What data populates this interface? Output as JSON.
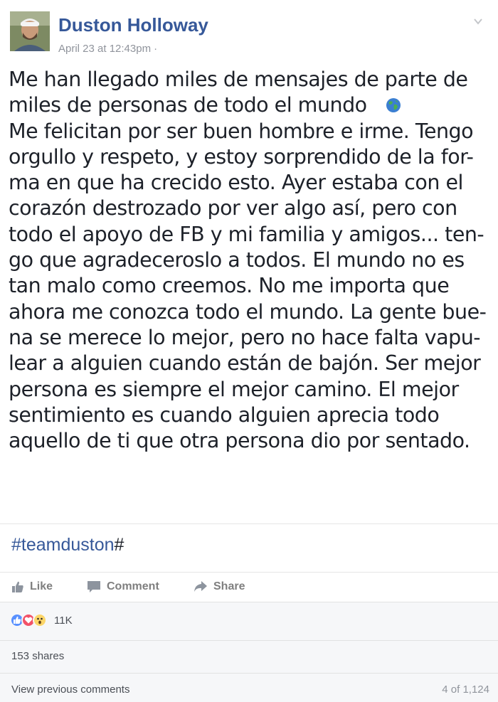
{
  "header": {
    "author": "Duston Holloway",
    "timestamp": "April 23 at 12:43pm",
    "privacy_separator": "·"
  },
  "post": {
    "lines": [
      "Me han llegado miles de mensajes de parte de",
      "miles de personas de todo el mundo",
      "Me felicitan por ser buen hombre e irme. Tengo",
      "orgullo y respeto, y estoy sorprendido de la for-",
      "ma en que ha crecido esto. Ayer estaba con el",
      "corazón destrozado por ver algo así, pero con",
      "todo el apoyo de FB y mi familia y amigos... ten-",
      "go que agradeceroslo a todos. El mundo no es",
      "tan malo como creemos. No me importa que",
      "ahora me conozca todo el mundo. La gente bue-",
      "na se merece lo mejor, pero no hace falta vapu-",
      "lear a alguien cuando están de bajón. Ser mejor",
      "persona es siempre el mejor camino. El mejor",
      "sentimiento es cuando alguien aprecia todo",
      "aquello de ti que otra persona dio por sentado."
    ],
    "hashtag": "#teamduston",
    "hashtag_suffix": "#"
  },
  "actions": {
    "like": "Like",
    "comment": "Comment",
    "share": "Share"
  },
  "footer": {
    "reaction_count": "11K",
    "shares": "153 shares",
    "view_previous": "View previous comments",
    "comment_position": "4 of 1,124"
  },
  "colors": {
    "link_blue": "#365899",
    "muted_gray": "#90949c",
    "like_blue": "#5890ff",
    "love_red": "#f25268",
    "wow_yellow": "#fcd669"
  },
  "icons": [
    "globe-icon",
    "chevron-down-icon",
    "like-thumb-icon",
    "comment-bubble-icon",
    "share-arrow-icon",
    "like-reaction-icon",
    "love-reaction-icon",
    "wow-reaction-icon"
  ]
}
